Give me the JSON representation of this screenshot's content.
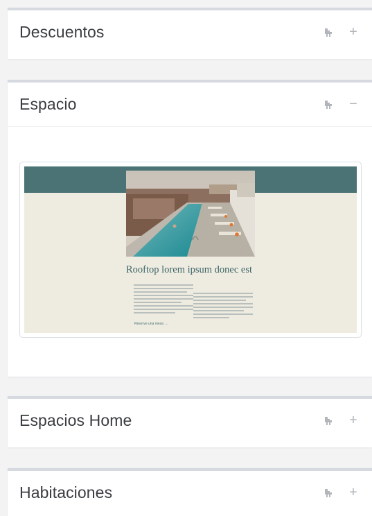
{
  "panels": [
    {
      "title": "Descuentos",
      "toggle": "+",
      "toggle_icon": "plus-icon",
      "move_icon": "move-icon"
    },
    {
      "title": "Espacio",
      "toggle": "−",
      "toggle_icon": "minus-icon",
      "move_icon": "move-icon",
      "preview": {
        "heading": "Rooftop lorem ipsum donec est",
        "link": "Reserve una mesa →",
        "band_color": "#4b7275",
        "bg_color": "#eeece0"
      }
    },
    {
      "title": "Espacios Home",
      "toggle": "+",
      "toggle_icon": "plus-icon",
      "move_icon": "move-icon"
    },
    {
      "title": "Habitaciones",
      "toggle": "+",
      "toggle_icon": "plus-icon",
      "move_icon": "move-icon"
    }
  ]
}
